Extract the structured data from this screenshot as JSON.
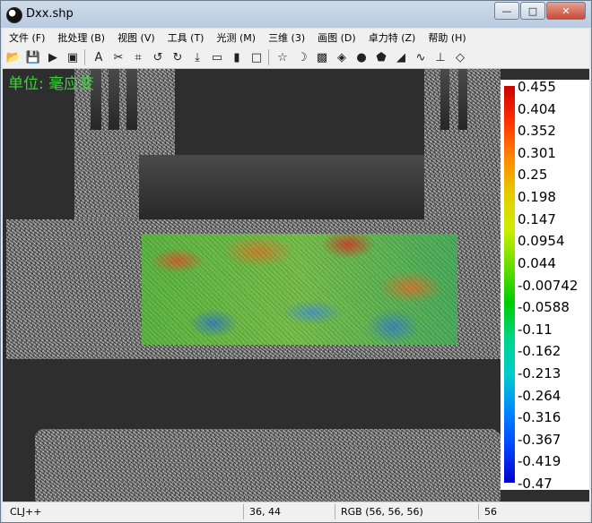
{
  "window": {
    "title": "Dxx.shp"
  },
  "menu": [
    {
      "label": "文件 (F)",
      "name": "menu-file"
    },
    {
      "label": "批处理 (B)",
      "name": "menu-batch"
    },
    {
      "label": "视图 (V)",
      "name": "menu-view"
    },
    {
      "label": "工具 (T)",
      "name": "menu-tools"
    },
    {
      "label": "光测 (M)",
      "name": "menu-optical"
    },
    {
      "label": "三维 (3)",
      "name": "menu-3d"
    },
    {
      "label": "画图 (D)",
      "name": "menu-draw"
    },
    {
      "label": "卓力特 (Z)",
      "name": "menu-zhuolite"
    },
    {
      "label": "帮助 (H)",
      "name": "menu-help"
    }
  ],
  "toolbar": [
    "open-icon",
    "save-icon",
    "play-icon",
    "tile-icon",
    "text-icon",
    "cut-icon",
    "crop-icon",
    "rotate-left-icon",
    "rotate-right-icon",
    "download-icon",
    "ruler-icon",
    "bar-chart-icon",
    "rectangle-icon",
    "star-icon",
    "moon-icon",
    "color-map-icon",
    "tag-icon",
    "circle-icon",
    "polygon-icon",
    "histogram-icon",
    "line-profile-icon",
    "axis-icon",
    "cube-icon"
  ],
  "overlay": {
    "units_label": "单位: 毫应变"
  },
  "colorbar": {
    "labels": [
      "0.455",
      "0.404",
      "0.352",
      "0.301",
      "0.25",
      "0.198",
      "0.147",
      "0.0954",
      "0.044",
      "-0.00742",
      "-0.0588",
      "-0.11",
      "-0.162",
      "-0.213",
      "-0.264",
      "-0.316",
      "-0.367",
      "-0.419",
      "-0.47"
    ]
  },
  "status": {
    "app": "CLJ++",
    "coords": "36, 44",
    "rgb": "RGB (56, 56, 56)",
    "value": "56"
  }
}
